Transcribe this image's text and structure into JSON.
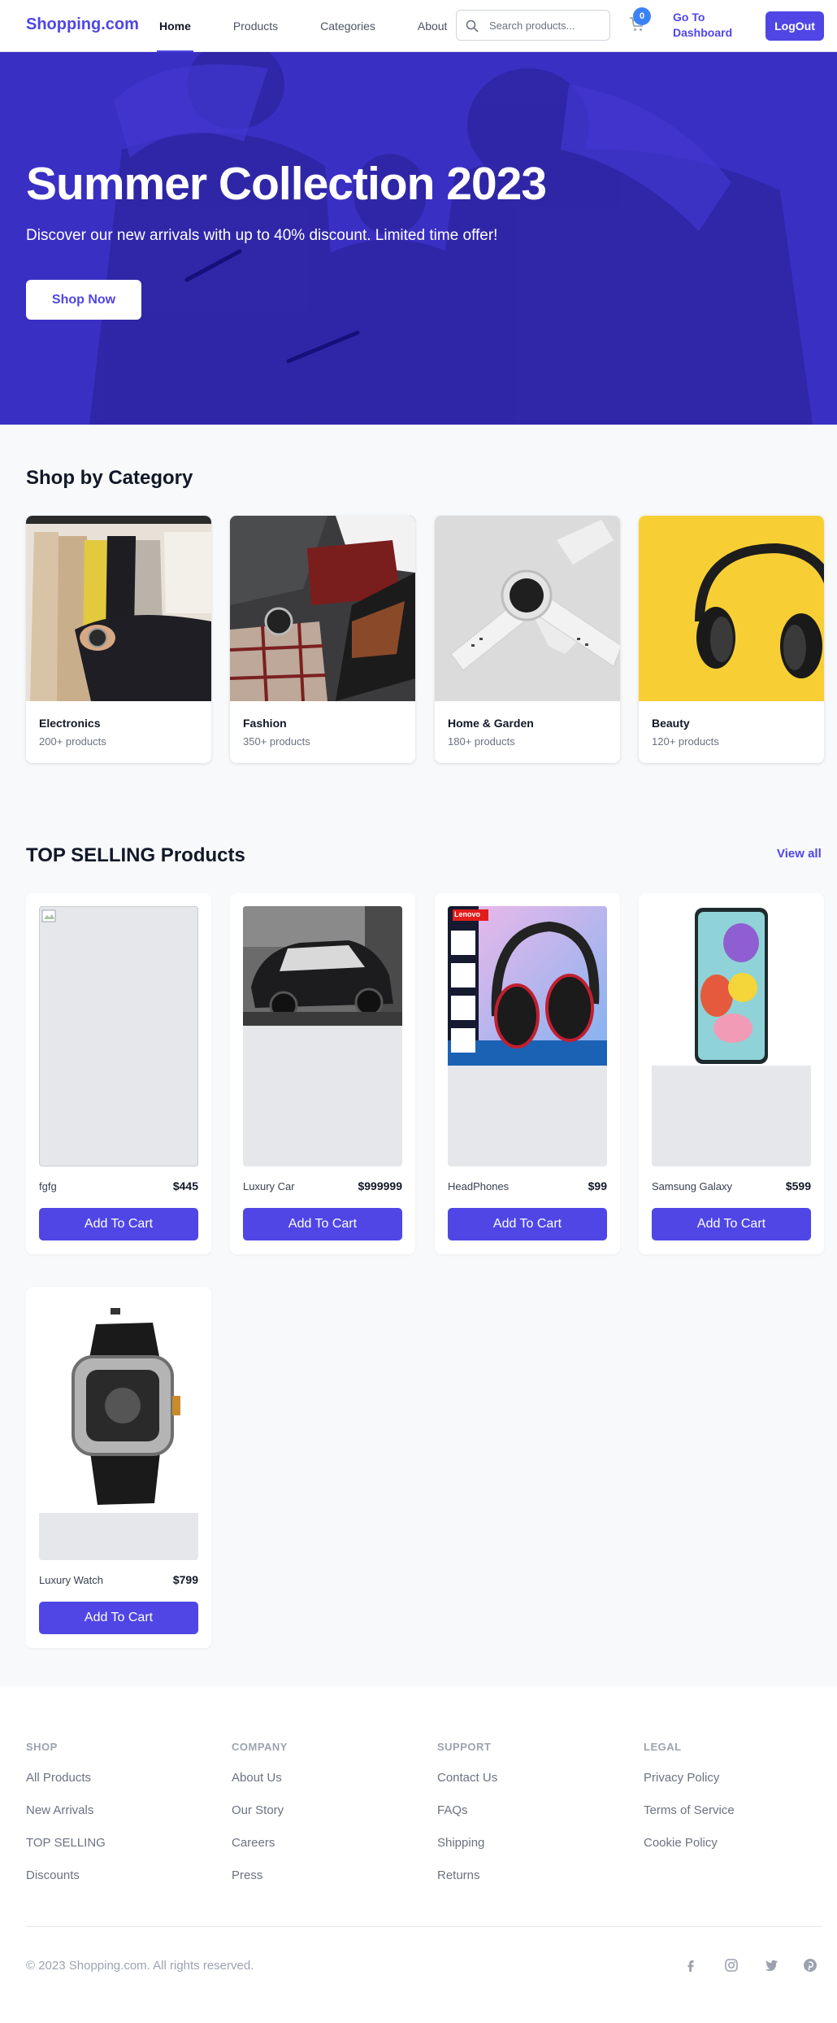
{
  "header": {
    "logo": "Shopping.com",
    "nav": [
      "Home",
      "Products",
      "Categories",
      "About"
    ],
    "search_placeholder": "Search products...",
    "cart_count": "0",
    "dashboard_label": "Go To Dashboard",
    "logout_label": "LogOut"
  },
  "hero": {
    "title": "Summer Collection 2023",
    "subtitle": "Discover our new arrivals with up to 40% discount. Limited time offer!",
    "cta": "Shop Now"
  },
  "categories": {
    "title": "Shop by Category",
    "items": [
      {
        "name": "Electronics",
        "count": "200+ products"
      },
      {
        "name": "Fashion",
        "count": "350+ products"
      },
      {
        "name": "Home & Garden",
        "count": "180+ products"
      },
      {
        "name": "Beauty",
        "count": "120+ products"
      }
    ]
  },
  "products": {
    "title": "TOP SELLING Products",
    "view_all": "View all",
    "add_label": "Add To Cart",
    "items": [
      {
        "name": "fgfg",
        "price": "$445"
      },
      {
        "name": "Luxury Car",
        "price": "$999999"
      },
      {
        "name": "HeadPhones",
        "price": "$99"
      },
      {
        "name": "Samsung Galaxy",
        "price": "$599"
      },
      {
        "name": "Luxury Watch",
        "price": "$799"
      }
    ]
  },
  "product_image_text": {
    "lenovo": "Lenovo"
  },
  "footer": {
    "columns": [
      {
        "heading": "SHOP",
        "links": [
          "All Products",
          "New Arrivals",
          "TOP SELLING",
          "Discounts"
        ]
      },
      {
        "heading": "COMPANY",
        "links": [
          "About Us",
          "Our Story",
          "Careers",
          "Press"
        ]
      },
      {
        "heading": "SUPPORT",
        "links": [
          "Contact Us",
          "FAQs",
          "Shipping",
          "Returns"
        ]
      },
      {
        "heading": "LEGAL",
        "links": [
          "Privacy Policy",
          "Terms of Service",
          "Cookie Policy"
        ]
      }
    ],
    "copyright": "© 2023 Shopping.com. All rights reserved.",
    "social_icons": [
      "facebook-icon",
      "instagram-icon",
      "twitter-icon",
      "pinterest-icon"
    ]
  },
  "colors": {
    "brand": "#4f46e5",
    "hero_overlay": "#3b30c4",
    "badge": "#3b82f6"
  }
}
